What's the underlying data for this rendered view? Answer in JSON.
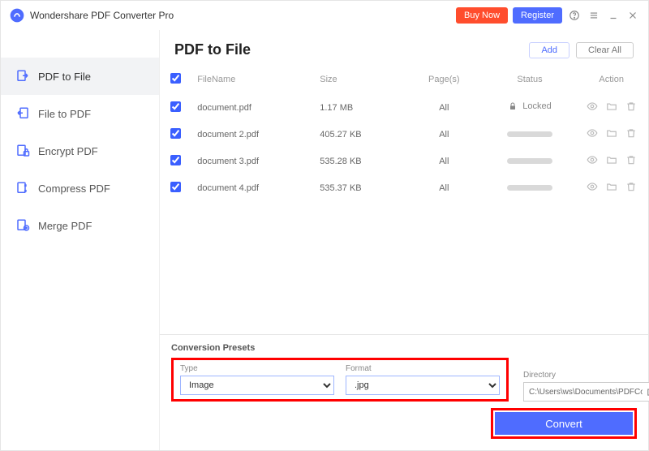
{
  "app": {
    "title": "Wondershare PDF Converter Pro"
  },
  "titlebar": {
    "buy": "Buy Now",
    "register": "Register"
  },
  "sidebar": {
    "items": [
      {
        "label": "PDF to File",
        "active": true
      },
      {
        "label": "File to PDF",
        "active": false
      },
      {
        "label": "Encrypt PDF",
        "active": false
      },
      {
        "label": "Compress PDF",
        "active": false
      },
      {
        "label": "Merge PDF",
        "active": false
      }
    ]
  },
  "main": {
    "title": "PDF to File",
    "add": "Add",
    "clearAll": "Clear All"
  },
  "table": {
    "headers": {
      "filename": "FileName",
      "size": "Size",
      "pages": "Page(s)",
      "status": "Status",
      "action": "Action"
    },
    "rows": [
      {
        "name": "document.pdf",
        "size": "1.17 MB",
        "pages": "All",
        "locked": true,
        "lockedLabel": "Locked"
      },
      {
        "name": "document 2.pdf",
        "size": "405.27 KB",
        "pages": "All",
        "locked": false
      },
      {
        "name": "document 3.pdf",
        "size": "535.28 KB",
        "pages": "All",
        "locked": false
      },
      {
        "name": "document 4.pdf",
        "size": "535.37 KB",
        "pages": "All",
        "locked": false
      }
    ]
  },
  "presets": {
    "title": "Conversion Presets",
    "typeLabel": "Type",
    "typeValue": "Image",
    "formatLabel": "Format",
    "formatValue": ".jpg",
    "directoryLabel": "Directory",
    "directoryValue": "C:\\Users\\ws\\Documents\\PDFConvert",
    "convert": "Convert"
  },
  "colors": {
    "accent": "#4f6cff",
    "orange": "#ff4d2d",
    "highlight": "#ff0000"
  }
}
